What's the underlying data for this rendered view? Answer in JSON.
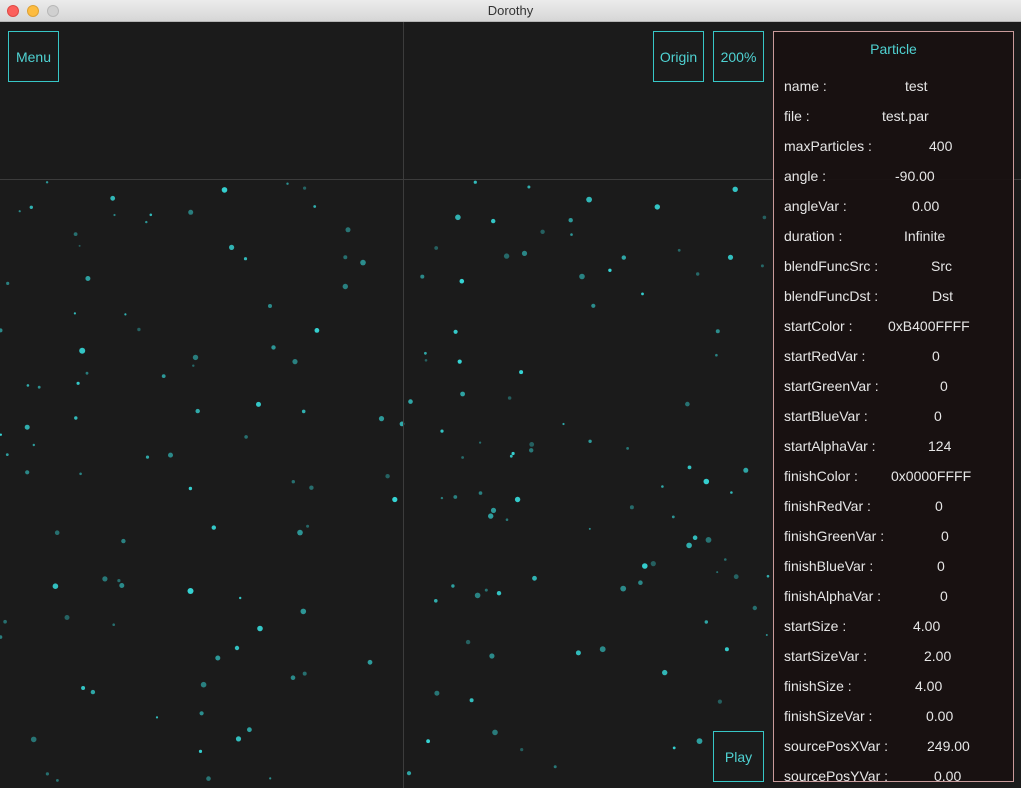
{
  "window": {
    "title": "Dorothy"
  },
  "buttons": {
    "menu": "Menu",
    "origin": "Origin",
    "zoom": "200%",
    "play": "Play"
  },
  "colors": {
    "accent": "#37c7c7",
    "particle": "#36d6d6",
    "panel_border": "#c89a9a"
  },
  "panel": {
    "title": "Particle",
    "rows": [
      {
        "key": "name :",
        "value": "test"
      },
      {
        "key": "file :",
        "value": "test.par"
      },
      {
        "key": "maxParticles :",
        "value": "400"
      },
      {
        "key": "angle :",
        "value": "-90.00"
      },
      {
        "key": "angleVar :",
        "value": "0.00"
      },
      {
        "key": "duration :",
        "value": "Infinite"
      },
      {
        "key": "blendFuncSrc :",
        "value": "Src"
      },
      {
        "key": "blendFuncDst :",
        "value": "Dst"
      },
      {
        "key": "startColor :",
        "value": "0xB400FFFF"
      },
      {
        "key": "startRedVar :",
        "value": "0"
      },
      {
        "key": "startGreenVar :",
        "value": "0"
      },
      {
        "key": "startBlueVar :",
        "value": "0"
      },
      {
        "key": "startAlphaVar :",
        "value": "124"
      },
      {
        "key": "finishColor :",
        "value": "0x0000FFFF"
      },
      {
        "key": "finishRedVar :",
        "value": "0"
      },
      {
        "key": "finishGreenVar :",
        "value": "0"
      },
      {
        "key": "finishBlueVar :",
        "value": "0"
      },
      {
        "key": "finishAlphaVar :",
        "value": "0"
      },
      {
        "key": "startSize :",
        "value": "4.00"
      },
      {
        "key": "startSizeVar :",
        "value": "2.00"
      },
      {
        "key": "finishSize :",
        "value": "4.00"
      },
      {
        "key": "finishSizeVar :",
        "value": "0.00"
      },
      {
        "key": "sourcePosXVar :",
        "value": "249.00"
      },
      {
        "key": "sourcePosYVar :",
        "value": "0.00"
      }
    ]
  }
}
